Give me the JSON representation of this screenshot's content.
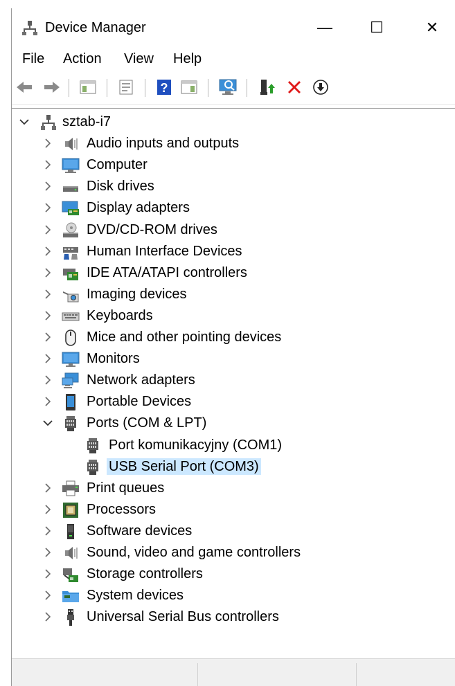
{
  "window": {
    "title": "Device Manager",
    "controls": {
      "minimize": "—",
      "maximize": "☐",
      "close": "✕"
    }
  },
  "menu": [
    "File",
    "Action",
    "View",
    "Help"
  ],
  "toolbar": {
    "buttons": [
      "back-arrow-icon",
      "forward-arrow-icon",
      "show-hide-console-tree-icon",
      "properties-icon",
      "help-icon",
      "show-action-pane-icon",
      "scan-hardware-changes-icon",
      "update-driver-icon",
      "uninstall-device-icon",
      "disable-device-icon"
    ],
    "colors": {
      "help_blue": "#1f4fbf",
      "uninstall_red": "#e01919",
      "update_green": "#2a9d2a"
    }
  },
  "tree": {
    "root": {
      "label": "sztab-i7",
      "expanded": true
    },
    "categories": [
      {
        "label": "Audio inputs and outputs",
        "icon": "speaker-icon",
        "expanded": false
      },
      {
        "label": "Computer",
        "icon": "computer-icon",
        "expanded": false
      },
      {
        "label": "Disk drives",
        "icon": "disk-drive-icon",
        "expanded": false
      },
      {
        "label": "Display adapters",
        "icon": "display-adapter-icon",
        "expanded": false
      },
      {
        "label": "DVD/CD-ROM drives",
        "icon": "dvd-drive-icon",
        "expanded": false
      },
      {
        "label": "Human Interface Devices",
        "icon": "hid-icon",
        "expanded": false
      },
      {
        "label": "IDE ATA/ATAPI controllers",
        "icon": "ide-controller-icon",
        "expanded": false
      },
      {
        "label": "Imaging devices",
        "icon": "camera-icon",
        "expanded": false
      },
      {
        "label": "Keyboards",
        "icon": "keyboard-icon",
        "expanded": false
      },
      {
        "label": "Mice and other pointing devices",
        "icon": "mouse-icon",
        "expanded": false
      },
      {
        "label": "Monitors",
        "icon": "monitor-icon",
        "expanded": false
      },
      {
        "label": "Network adapters",
        "icon": "network-adapter-icon",
        "expanded": false
      },
      {
        "label": "Portable Devices",
        "icon": "portable-device-icon",
        "expanded": false
      },
      {
        "label": "Ports (COM & LPT)",
        "icon": "port-connector-icon",
        "expanded": true,
        "children": [
          {
            "label": "Port komunikacyjny (COM1)",
            "icon": "port-connector-icon",
            "selected": false
          },
          {
            "label": "USB Serial Port (COM3)",
            "icon": "port-connector-icon",
            "selected": true
          }
        ]
      },
      {
        "label": "Print queues",
        "icon": "printer-icon",
        "expanded": false
      },
      {
        "label": "Processors",
        "icon": "processor-icon",
        "expanded": false
      },
      {
        "label": "Software devices",
        "icon": "software-device-icon",
        "expanded": false
      },
      {
        "label": "Sound, video and game controllers",
        "icon": "speaker-icon",
        "expanded": false
      },
      {
        "label": "Storage controllers",
        "icon": "storage-controller-icon",
        "expanded": false
      },
      {
        "label": "System devices",
        "icon": "system-folder-icon",
        "expanded": false
      },
      {
        "label": "Universal Serial Bus controllers",
        "icon": "usb-plug-icon",
        "expanded": false
      }
    ]
  },
  "colors": {
    "selection": "#cce8ff",
    "statusbar": "#f0f0f0"
  }
}
